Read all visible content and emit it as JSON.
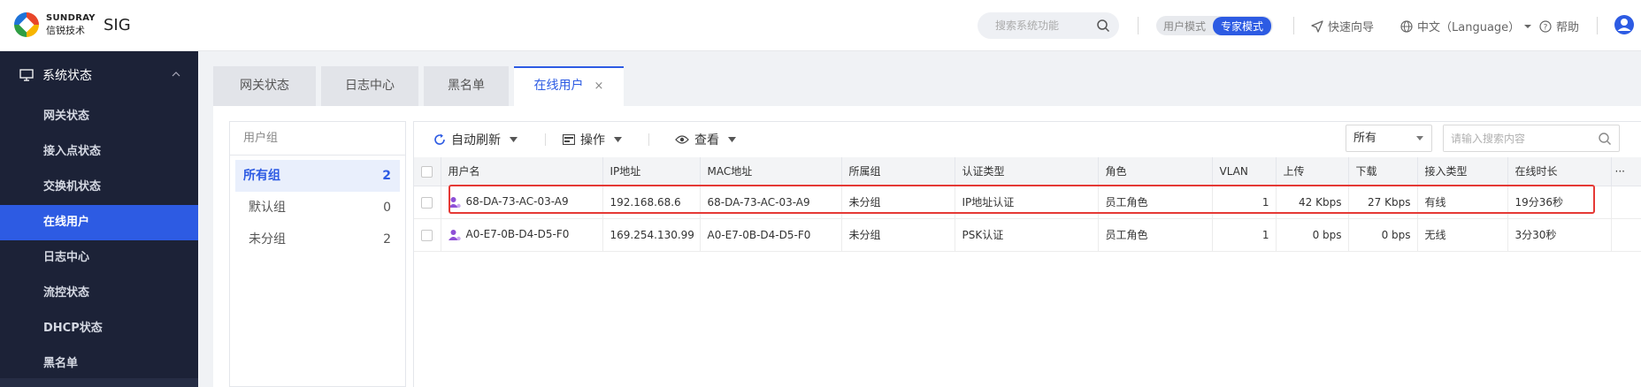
{
  "header": {
    "logo_brand": "SUNDRAY",
    "logo_cn": "信锐技术",
    "app_title": "SIG",
    "search_placeholder": "搜索系统功能",
    "mode_user": "用户模式",
    "mode_expert": "专家模式",
    "quick_guide": "快速向导",
    "language": "中文（Language）",
    "help": "帮助"
  },
  "sidebar": {
    "group_label": "系统状态",
    "items": [
      {
        "label": "网关状态"
      },
      {
        "label": "接入点状态"
      },
      {
        "label": "交换机状态"
      },
      {
        "label": "在线用户"
      },
      {
        "label": "日志中心"
      },
      {
        "label": "流控状态"
      },
      {
        "label": "DHCP状态"
      },
      {
        "label": "黑名单"
      }
    ]
  },
  "tabs": [
    {
      "label": "网关状态"
    },
    {
      "label": "日志中心"
    },
    {
      "label": "黑名单"
    },
    {
      "label": "在线用户"
    }
  ],
  "groups": {
    "title": "用户组",
    "items": [
      {
        "label": "所有组",
        "count": "2"
      },
      {
        "label": "默认组",
        "count": "0"
      },
      {
        "label": "未分组",
        "count": "2"
      }
    ]
  },
  "toolbar": {
    "auto_refresh": "自动刷新",
    "operate": "操作",
    "view": "查看",
    "filter_value": "所有",
    "search_placeholder": "请输入搜索内容"
  },
  "table": {
    "columns": [
      "用户名",
      "IP地址",
      "MAC地址",
      "所属组",
      "认证类型",
      "角色",
      "VLAN",
      "上传",
      "下载",
      "接入类型",
      "在线时长"
    ],
    "more": "···",
    "rows": [
      {
        "username": "68-DA-73-AC-03-A9",
        "ip": "192.168.68.6",
        "mac": "68-DA-73-AC-03-A9",
        "group": "未分组",
        "auth": "IP地址认证",
        "role": "员工角色",
        "vlan": "1",
        "upload": "42 Kbps",
        "download": "27 Kbps",
        "access": "有线",
        "duration": "19分36秒"
      },
      {
        "username": "A0-E7-0B-D4-D5-F0",
        "ip": "169.254.130.99",
        "mac": "A0-E7-0B-D4-D5-F0",
        "group": "未分组",
        "auth": "PSK认证",
        "role": "员工角色",
        "vlan": "1",
        "upload": "0 bps",
        "download": "0 bps",
        "access": "无线",
        "duration": "3分30秒"
      }
    ]
  },
  "colors": {
    "accent": "#2d5be3",
    "sidebar_bg": "#1c2237",
    "highlight": "#e53935",
    "user_icon": "#8e4fd6"
  }
}
